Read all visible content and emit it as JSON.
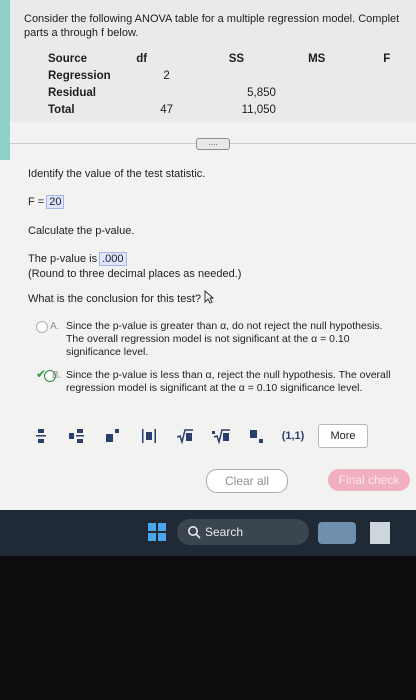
{
  "instructions": {
    "line1": "Consider the following ANOVA table for a multiple regression model. Complet",
    "line2": "parts a through f below."
  },
  "anova": {
    "headers": [
      "Source",
      "df",
      "SS",
      "MS",
      "F"
    ],
    "rows": [
      {
        "source": "Regression",
        "df": "2",
        "ss": "",
        "ms": "",
        "f": ""
      },
      {
        "source": "Residual",
        "df": "",
        "ss": "5,850",
        "ms": "",
        "f": ""
      },
      {
        "source": "Total",
        "df": "47",
        "ss": "11,050",
        "ms": "",
        "f": ""
      }
    ]
  },
  "expand_button": "....",
  "question1": {
    "prompt": "Identify the value of the test statistic.",
    "label": "F =",
    "answer": "20"
  },
  "question2": {
    "prompt": "Calculate the p-value.",
    "label": "The p-value is",
    "answer": ".000",
    "note": "(Round to three decimal places as needed.)"
  },
  "question3": {
    "prompt": "What is the conclusion for this test?",
    "options": [
      {
        "letter": "A.",
        "line1": "Since the p-value is greater than α, do not reject the null hypothesis.",
        "line2": "The overall regression model is not significant at the α = 0.10",
        "line3": "significance level.",
        "selected": false
      },
      {
        "letter": "B.",
        "line1": "Since the p-value is less than α, reject the null hypothesis. The overall",
        "line2": "regression model is significant at the α = 0.10 significance level.",
        "selected": true
      }
    ]
  },
  "toolbar": {
    "tools": [
      "fraction-icon",
      "mixed-number-icon",
      "superscript-icon",
      "absolute-value-icon",
      "square-root-icon",
      "nth-root-icon",
      "subscript-icon",
      "ordered-pair-icon"
    ],
    "ordered_pair_label": "(1,1)",
    "more_label": "More"
  },
  "buttons": {
    "clear_all": "Clear all",
    "final_check": "Final check"
  },
  "taskbar": {
    "search_label": "Search"
  },
  "colors": {
    "accent_teal": "#8fd0c8",
    "answer_box": "#dfe4ff",
    "final_check": "#f1b0c2",
    "taskbar": "#1f2a36",
    "check_green": "#2f9b3f"
  }
}
